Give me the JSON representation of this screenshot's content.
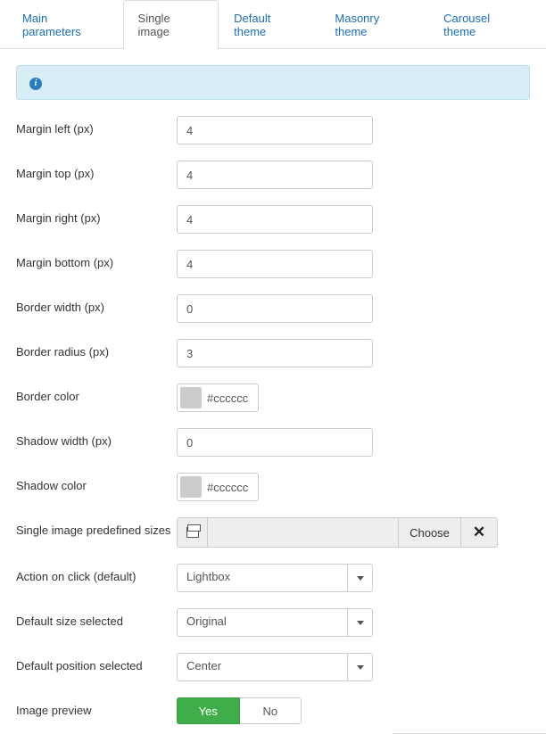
{
  "tabs": {
    "main_parameters": "Main parameters",
    "single_image": "Single image",
    "default_theme": "Default theme",
    "masonry_theme": "Masonry theme",
    "carousel_theme": "Carousel theme"
  },
  "fields": {
    "margin_left": {
      "label": "Margin left (px)",
      "value": "4"
    },
    "margin_top": {
      "label": "Margin top (px)",
      "value": "4"
    },
    "margin_right": {
      "label": "Margin right (px)",
      "value": "4"
    },
    "margin_bottom": {
      "label": "Margin bottom (px)",
      "value": "4"
    },
    "border_width": {
      "label": "Border width (px)",
      "value": "0"
    },
    "border_radius": {
      "label": "Border radius (px)",
      "value": "3"
    },
    "border_color": {
      "label": "Border color",
      "value": "#cccccc"
    },
    "shadow_width": {
      "label": "Shadow width (px)",
      "value": "0"
    },
    "shadow_color": {
      "label": "Shadow color",
      "value": "#cccccc"
    },
    "predefined_sizes": {
      "label": "Single image predefined sizes",
      "choose": "Choose"
    },
    "action_on_click": {
      "label": "Action on click (default)",
      "value": "Lightbox"
    },
    "default_size": {
      "label": "Default size selected",
      "value": "Original"
    },
    "default_position": {
      "label": "Default position selected",
      "value": "Center"
    },
    "image_preview": {
      "label": "Image preview",
      "yes": "Yes",
      "no": "No"
    }
  }
}
